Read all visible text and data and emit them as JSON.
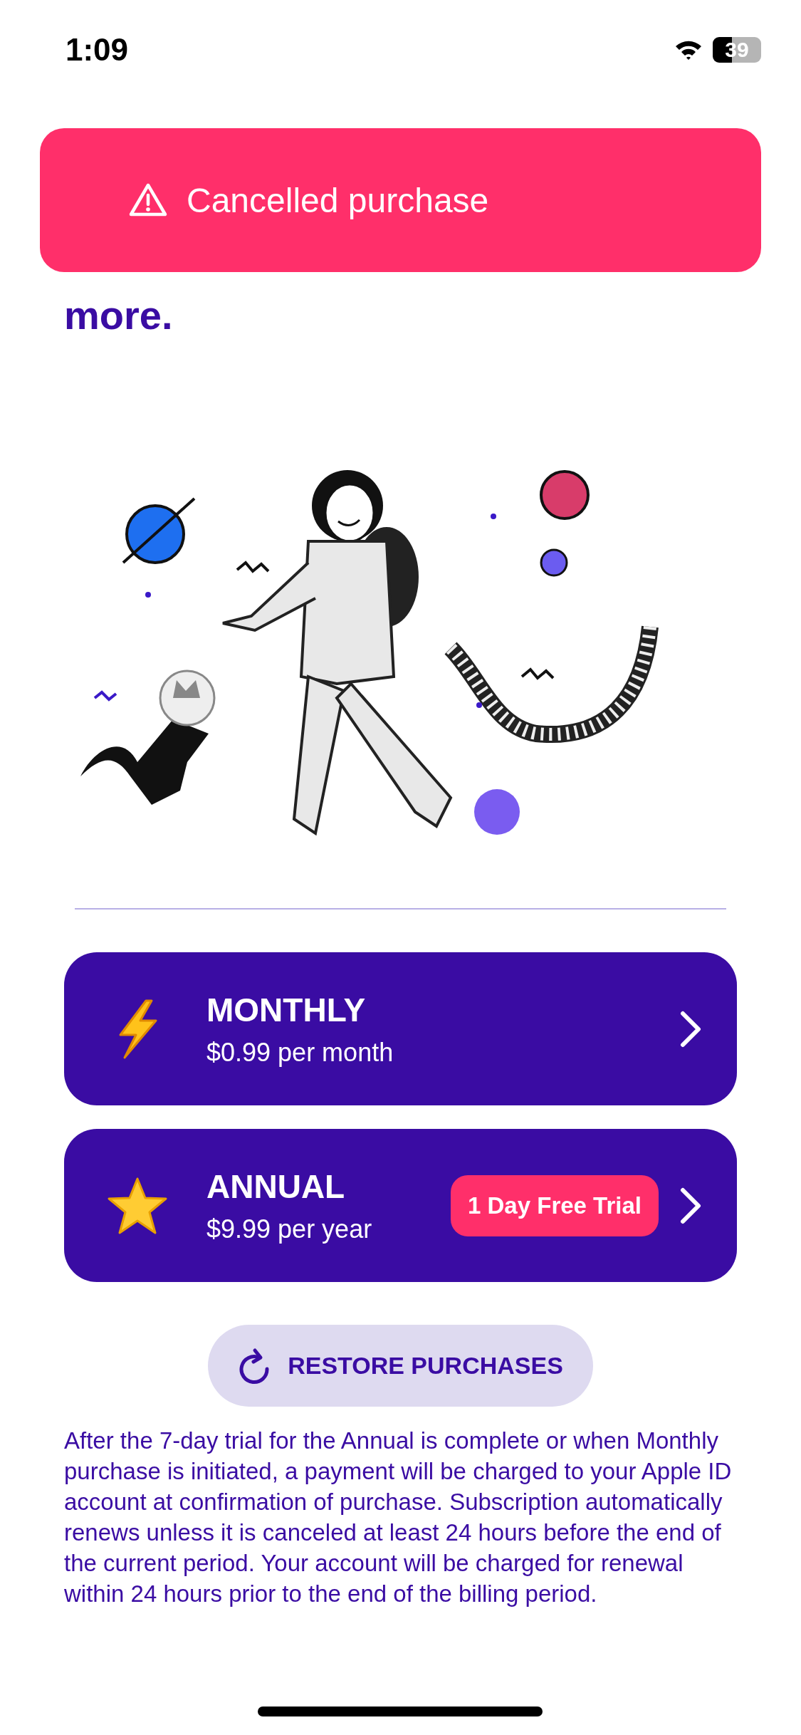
{
  "status_bar": {
    "time": "1:09",
    "battery": "39"
  },
  "toast": {
    "kind": "warning",
    "message": "Cancelled purchase"
  },
  "heading": {
    "visible_tail": "more."
  },
  "plans": [
    {
      "kind": "bolt",
      "title": "MONTHLY",
      "price": "$0.99 per month"
    },
    {
      "kind": "star",
      "title": "ANNUAL",
      "price": "$9.99 per year",
      "badge": "1 Day Free Trial"
    }
  ],
  "restore_button": {
    "label": "RESTORE PURCHASES"
  },
  "disclaimer": "After the 7-day trial for the Annual is complete or when Monthly purchase is initiated, a payment will be charged to your Apple ID account at confirmation of purchase. Subscription automatically renews unless it is canceled at least 24 hours before the end of the current period. Your account will be charged for renewal within 24 hours prior to the end of the billing period."
}
